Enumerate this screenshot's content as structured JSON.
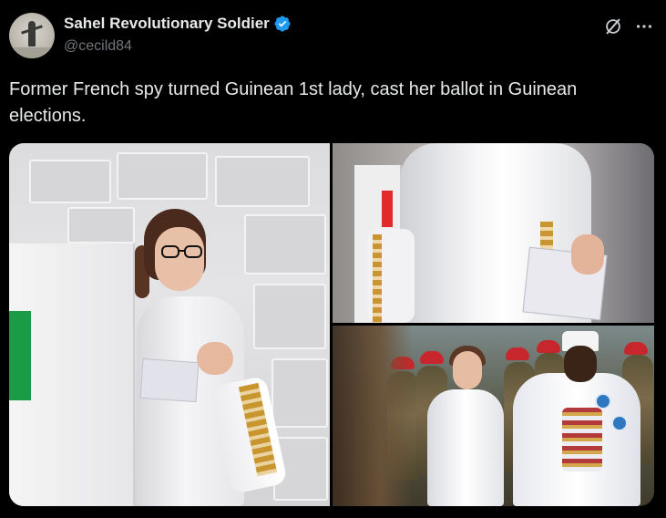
{
  "author": {
    "display_name": "Sahel Revolutionary Soldier",
    "handle": "@cecild84",
    "verified": true
  },
  "tweet": {
    "text": "Former French spy turned Guinean 1st lady, cast her ballot in Guinean elections."
  },
  "header_actions": {
    "grok_icon": "grok-icon",
    "more_icon": "more-icon"
  },
  "colors": {
    "background": "#000000",
    "text_primary": "#e7e9ea",
    "text_secondary": "#71767b",
    "verified_badge": "#1d9bf0"
  }
}
